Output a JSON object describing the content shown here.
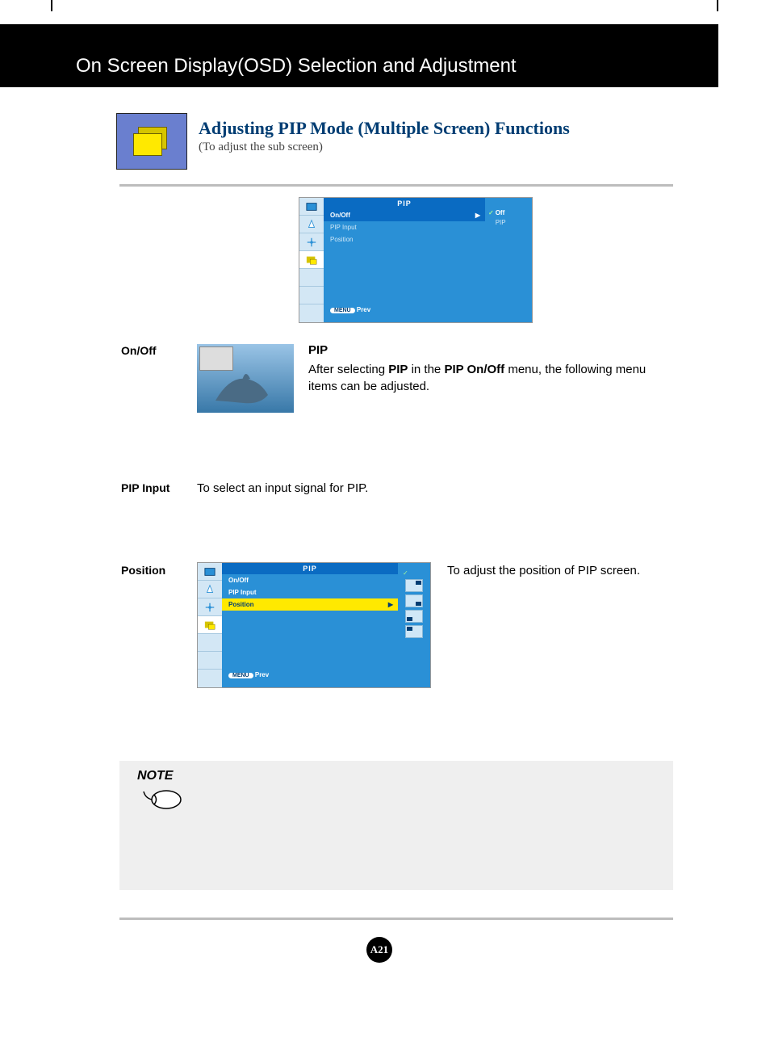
{
  "header": {
    "title": "On Screen Display(OSD) Selection and Adjustment"
  },
  "hero": {
    "title": "Adjusting PIP Mode (Multiple Screen) Functions",
    "subtitle": "(To adjust the sub screen)"
  },
  "osd1": {
    "title": "PIP",
    "items": [
      "On/Off",
      "PIP Input",
      "Position"
    ],
    "highlight_index": 0,
    "options": [
      "Off",
      "PIP"
    ],
    "selected_option_index": 0,
    "footer_btn": "MENU",
    "footer_label": "Prev"
  },
  "osd2": {
    "title": "PIP",
    "items": [
      "On/Off",
      "PIP Input",
      "Position"
    ],
    "highlight_index": 2,
    "footer_btn": "MENU",
    "footer_label": "Prev"
  },
  "rows": {
    "onoff": {
      "label": "On/Off",
      "pip_label": "PIP",
      "desc_1": "After selecting ",
      "desc_b1": "PIP",
      "desc_2": " in the ",
      "desc_b2": "PIP On/Off",
      "desc_3": " menu, the following menu items can be adjusted."
    },
    "pipinput": {
      "label": "PIP Input",
      "desc": "To select an input signal for PIP."
    },
    "position": {
      "label": "Position",
      "desc": "To adjust the position of PIP screen."
    }
  },
  "note": {
    "label": "NOTE"
  },
  "page_number": "A21"
}
